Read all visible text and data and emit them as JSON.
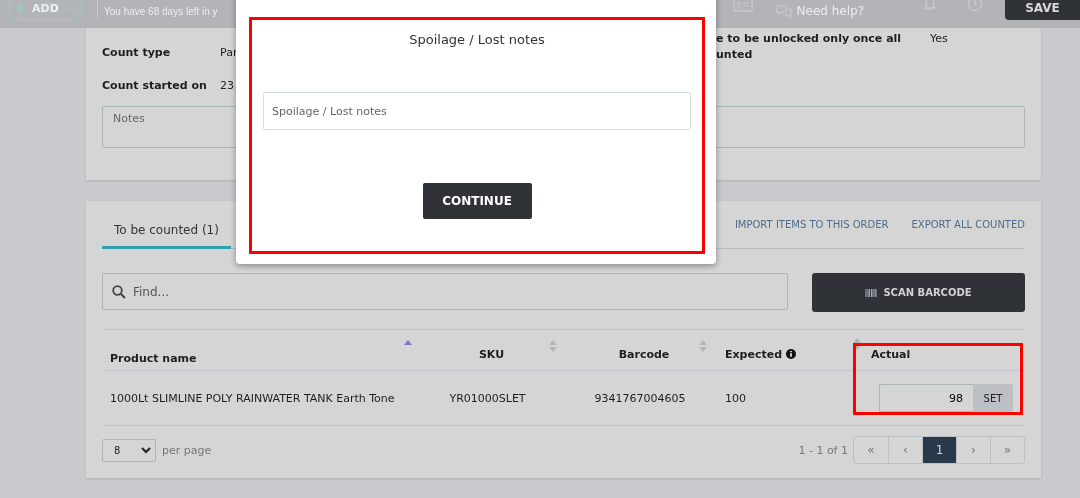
{
  "top_bar": {
    "add_button": "ADD",
    "trial_notice": "You have 68 days left in y",
    "help_link": "Need help?",
    "save_button": "SAVE"
  },
  "details": {
    "fields": [
      {
        "label": "Count type",
        "value": "Par"
      },
      {
        "label": "Count started on",
        "value": "23"
      }
    ],
    "side_fields": [
      {
        "label": "e to be unlocked only once all unted",
        "value": "Yes"
      }
    ],
    "notes": {
      "placeholder": "Notes"
    }
  },
  "items_panel": {
    "tabs": [
      {
        "label": "To be counted (1)",
        "selected": true
      }
    ],
    "links": [
      "IMPORT ITEMS TO THIS ORDER",
      "EXPORT ALL COUNTED"
    ],
    "search": {
      "placeholder": "Find..."
    },
    "scan_button": "SCAN BARCODE",
    "table": {
      "columns": [
        {
          "label": "Product name",
          "sortable": true,
          "sort_active": true
        },
        {
          "label": "SKU",
          "sortable": true,
          "sort_active": false
        },
        {
          "label": "Barcode",
          "sortable": true,
          "sort_active": false
        },
        {
          "label": "Expected",
          "info": true
        },
        {
          "label": "Actual",
          "sortable": true,
          "sort_active": false
        }
      ],
      "rows": [
        {
          "product": "1000Lt SLIMLINE POLY RAINWATER TANK Earth Tone",
          "sku": "YR01000SLET",
          "barcode": "9341767004605",
          "expected": "100",
          "actual": "98",
          "set_button": "SET"
        }
      ]
    },
    "per_page": {
      "value": "8",
      "label": "per page"
    },
    "pagination": {
      "range": "1 - 1 of 1",
      "buttons": [
        {
          "label": "«",
          "selected": false
        },
        {
          "label": "‹",
          "selected": false
        },
        {
          "label": "1",
          "selected": true
        },
        {
          "label": "›",
          "selected": false
        },
        {
          "label": "»",
          "selected": false
        }
      ]
    }
  },
  "modal": {
    "title": "Spoilage / Lost notes",
    "input": {
      "placeholder": "Spoilage / Lost notes"
    },
    "button": "CONTINUE"
  }
}
